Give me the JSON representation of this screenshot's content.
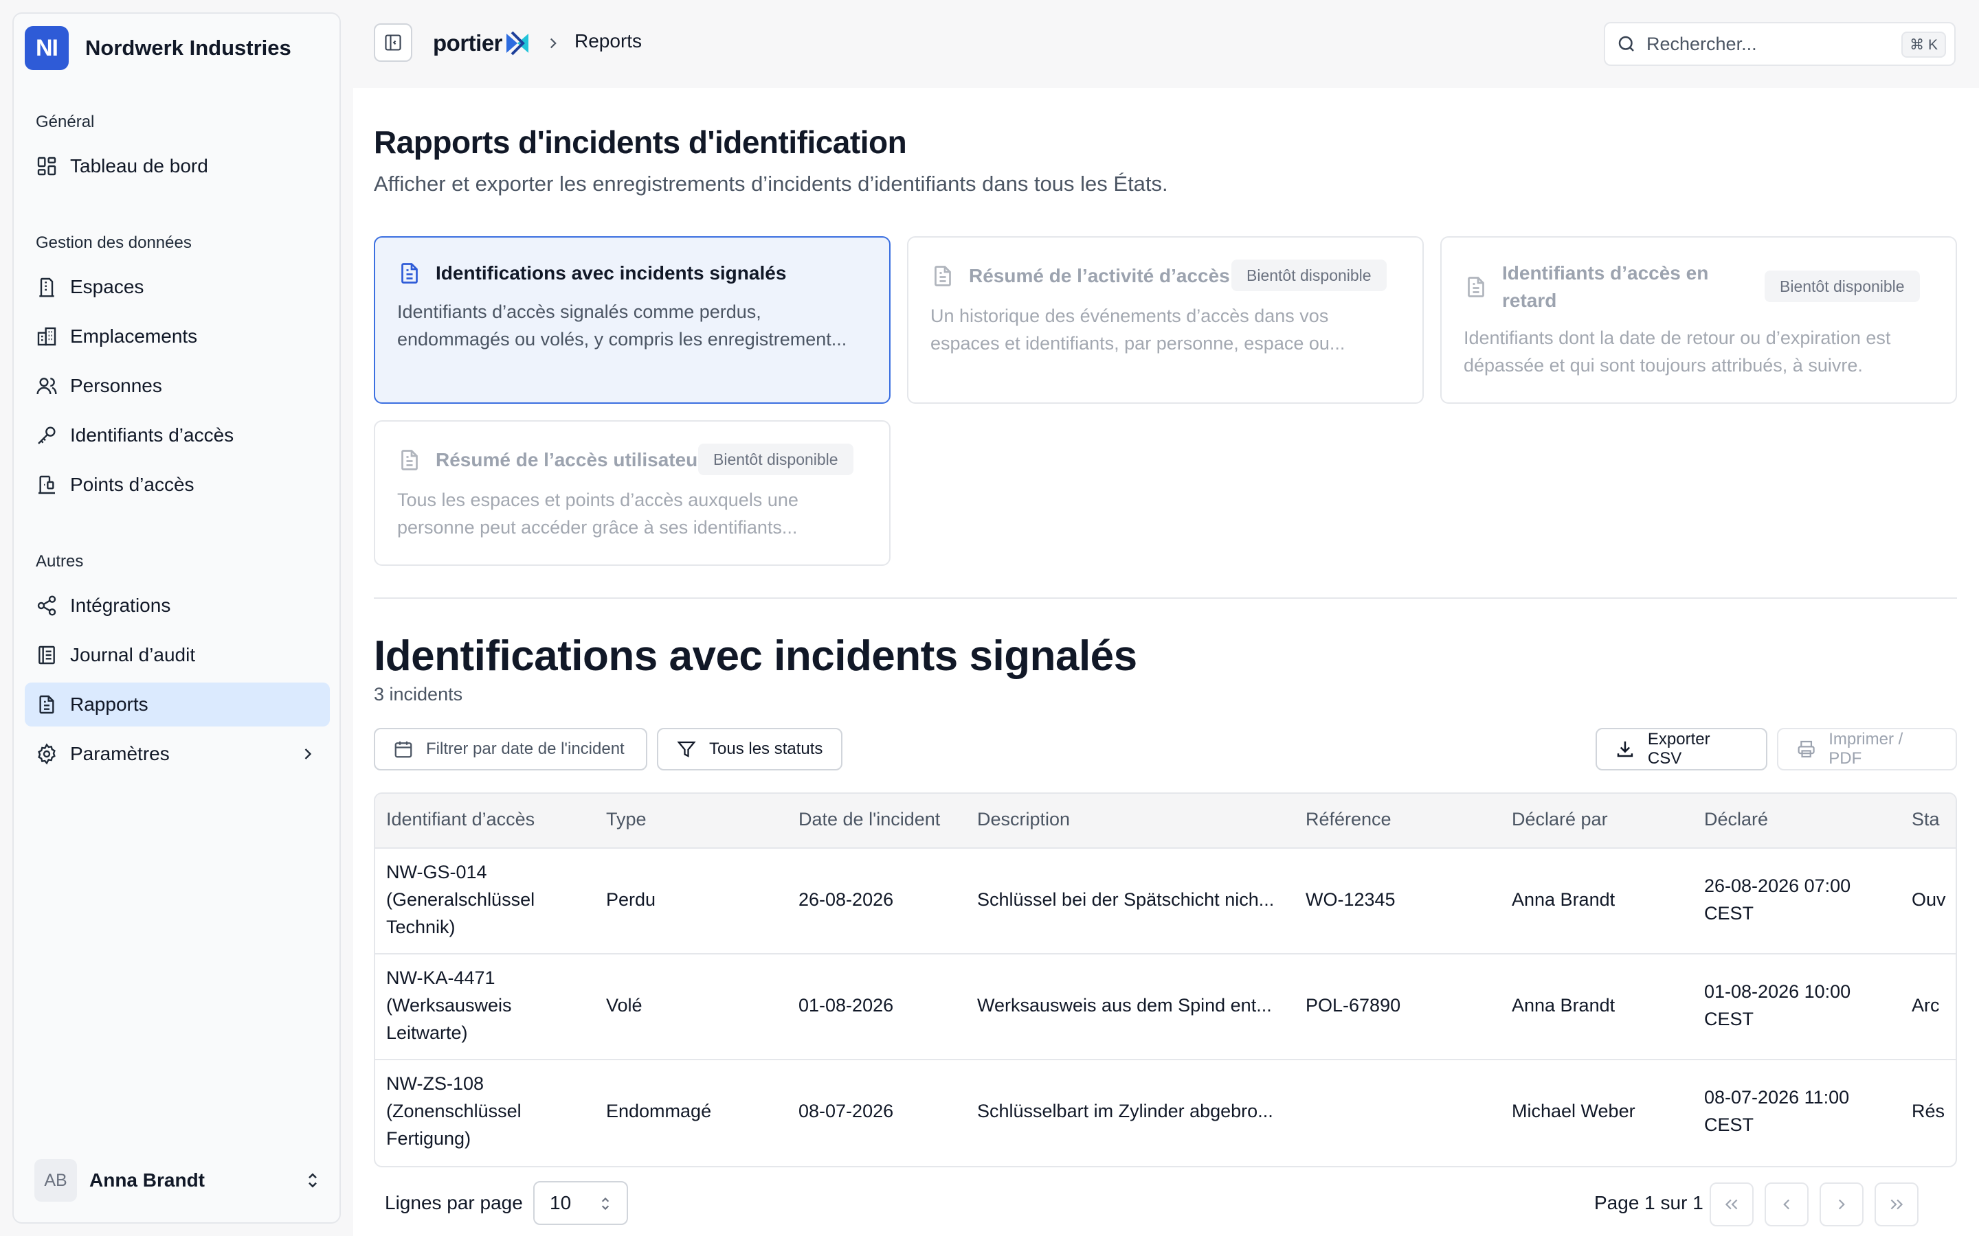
{
  "sidebar": {
    "org_initials": "NI",
    "org_name": "Nordwerk Industries",
    "groups": {
      "general": "Général",
      "data": "Gestion des données",
      "other": "Autres"
    },
    "items": [
      {
        "label": "Tableau de bord",
        "icon": "dashboard-icon"
      },
      {
        "label": "Espaces",
        "icon": "building-icon"
      },
      {
        "label": "Emplacements",
        "icon": "buildings-icon"
      },
      {
        "label": "Personnes",
        "icon": "users-icon"
      },
      {
        "label": "Identifiants d’accès",
        "icon": "key-icon"
      },
      {
        "label": "Points d’accès",
        "icon": "door-icon"
      },
      {
        "label": "Intégrations",
        "icon": "share-icon"
      },
      {
        "label": "Journal d’audit",
        "icon": "logbook-icon"
      },
      {
        "label": "Rapports",
        "icon": "report-icon"
      },
      {
        "label": "Paramètres",
        "icon": "gear-icon"
      }
    ],
    "user": {
      "initials": "AB",
      "name": "Anna Brandt"
    }
  },
  "topbar": {
    "brand": "portier",
    "breadcrumb": "Reports",
    "search_placeholder": "Rechercher...",
    "shortcut": "⌘ K"
  },
  "page": {
    "title": "Rapports d'incidents d'identification",
    "subtitle": "Afficher et exporter les enregistrements d’incidents d’identifiants dans tous les États."
  },
  "cards": [
    {
      "title": "Identifications avec incidents signalés",
      "desc1": "Identifiants d’accès signalés comme perdus,",
      "desc2": "endommagés ou volés, y compris les enregistrement...",
      "badge": ""
    },
    {
      "title": "Résumé de l’activité d’accès",
      "desc1": "Un historique des événements d’accès dans vos",
      "desc2": "espaces et identifiants, par personne, espace ou...",
      "badge": "Bientôt disponible"
    },
    {
      "title1": "Identifiants d’accès en",
      "title2": "retard",
      "desc1": "Identifiants dont la date de retour ou d’expiration est",
      "desc2": "dépassée et qui sont toujours attribués, à suivre.",
      "badge": "Bientôt disponible"
    },
    {
      "title": "Résumé de l’accès utilisateur",
      "desc1": "Tous les espaces et points d’accès auxquels une",
      "desc2": "personne peut accéder grâce à ses identifiants...",
      "badge": "Bientôt disponible"
    }
  ],
  "section": {
    "title": "Identifications avec incidents signalés",
    "count": "3 incidents",
    "filter_date": "Filtrer par date de l'incident",
    "filter_status": "Tous les statuts",
    "export_csv": "Exporter CSV",
    "print_pdf": "Imprimer / PDF"
  },
  "table": {
    "headers": [
      "Identifiant d’accès",
      "Type",
      "Date de l'incident",
      "Description",
      "Référence",
      "Déclaré par",
      "Déclaré",
      "Sta"
    ],
    "rows": [
      {
        "id1": "NW-GS-014",
        "id2": "(Generalschlüssel",
        "id3": "Technik)",
        "type": "Perdu",
        "date": "26-08-2026",
        "description": "Schlüssel bei der Spätschicht nich...",
        "reference": "WO-12345",
        "reported_by": "Anna Brandt",
        "reported1": "26-08-2026 07:00",
        "reported2": "CEST",
        "status": "Ouv"
      },
      {
        "id1": "NW-KA-4471",
        "id2": "(Werksausweis",
        "id3": "Leitwarte)",
        "type": "Volé",
        "date": "01-08-2026",
        "description": "Werksausweis aus dem Spind ent...",
        "reference": "POL-67890",
        "reported_by": "Anna Brandt",
        "reported1": "01-08-2026 10:00",
        "reported2": "CEST",
        "status": "Arc"
      },
      {
        "id1": "NW-ZS-108",
        "id2": "(Zonenschlüssel",
        "id3": "Fertigung)",
        "type": "Endommagé",
        "date": "08-07-2026",
        "description": "Schlüsselbart im Zylinder abgebro...",
        "reference": "",
        "reported_by": "Michael Weber",
        "reported1": "08-07-2026 11:00",
        "reported2": "CEST",
        "status": "Rés"
      }
    ]
  },
  "pagination": {
    "rows_label": "Lignes par page",
    "rows_value": "10",
    "page_info": "Page 1 sur 1"
  },
  "colors": {
    "accent": "#2e5bd7",
    "active_nav": "#dbeafe",
    "selected_card": "#eef3fc"
  }
}
